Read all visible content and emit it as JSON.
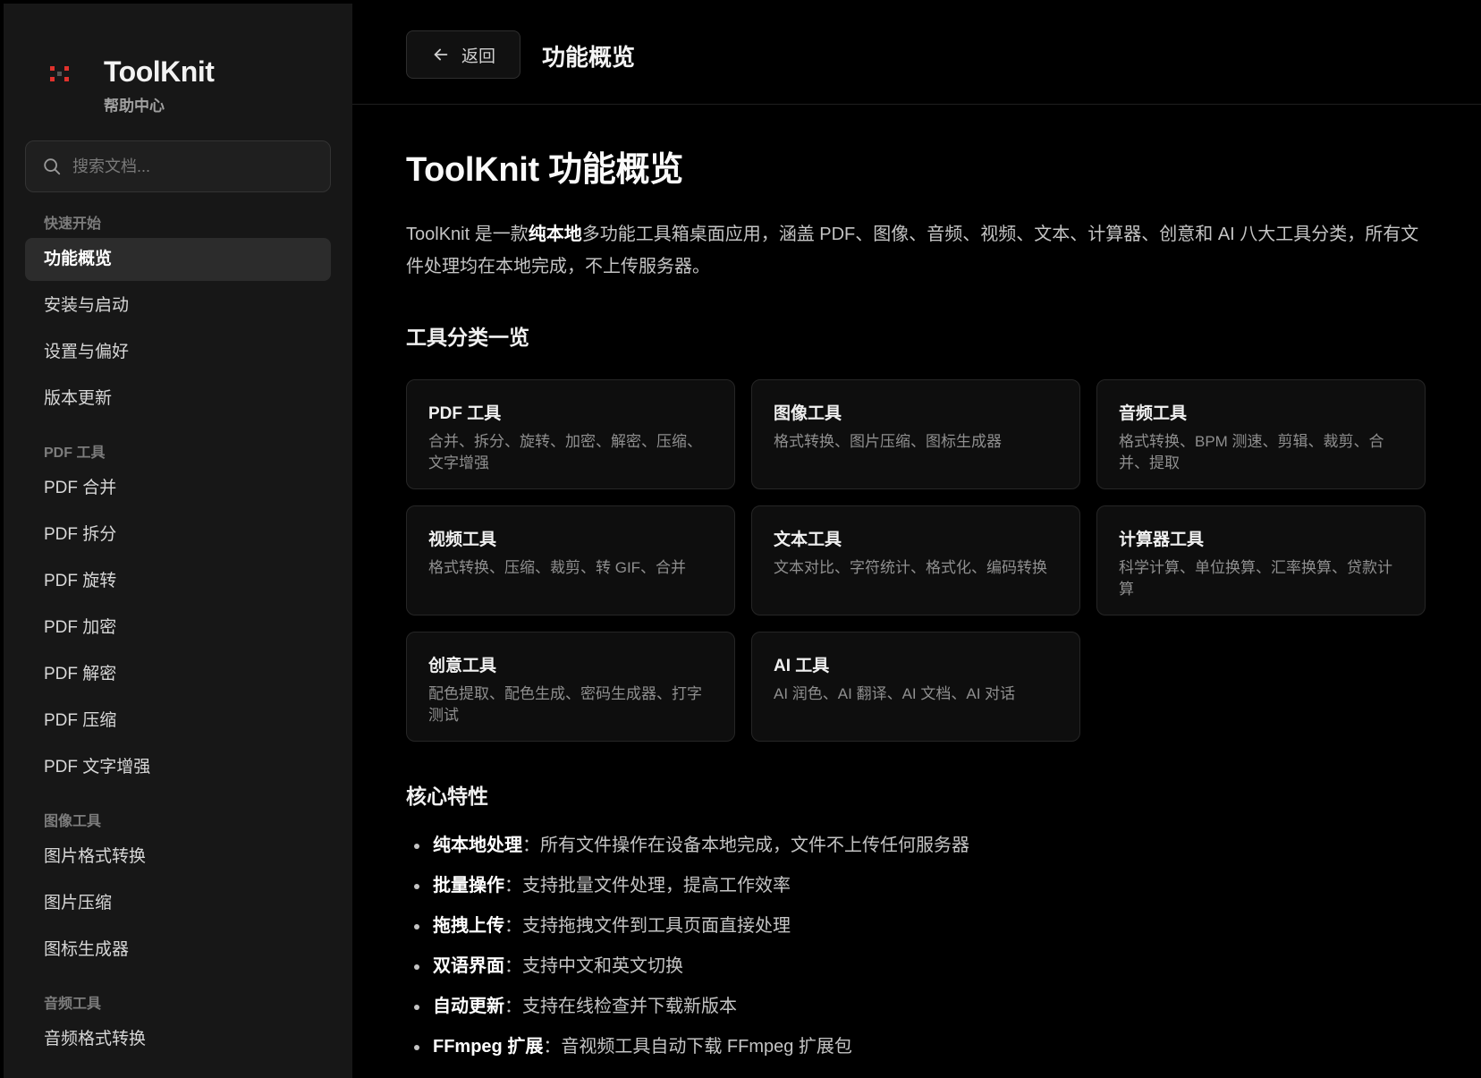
{
  "sidebar": {
    "brand_name": "ToolKnit",
    "brand_sub": "帮助中心",
    "search_placeholder": "搜索文档...",
    "sections": [
      {
        "title": "快速开始",
        "items": [
          "功能概览",
          "安装与启动",
          "设置与偏好",
          "版本更新"
        ]
      },
      {
        "title": "PDF 工具",
        "items": [
          "PDF 合并",
          "PDF 拆分",
          "PDF 旋转",
          "PDF 加密",
          "PDF 解密",
          "PDF 压缩",
          "PDF 文字增强"
        ]
      },
      {
        "title": "图像工具",
        "items": [
          "图片格式转换",
          "图片压缩",
          "图标生成器"
        ]
      },
      {
        "title": "音频工具",
        "items": [
          "音频格式转换"
        ]
      }
    ],
    "active_item": "功能概览"
  },
  "topbar": {
    "back_label": "返回",
    "title": "功能概览"
  },
  "content": {
    "h1": "ToolKnit 功能概览",
    "intro_before": "ToolKnit 是一款",
    "intro_bold": "纯本地",
    "intro_after": "多功能工具箱桌面应用，涵盖 PDF、图像、音频、视频、文本、计算器、创意和 AI 八大工具分类，所有文件处理均在本地完成，不上传服务器。",
    "tools_heading": "工具分类一览",
    "cards": [
      {
        "title": "PDF 工具",
        "desc": "合并、拆分、旋转、加密、解密、压缩、文字增强"
      },
      {
        "title": "图像工具",
        "desc": "格式转换、图片压缩、图标生成器"
      },
      {
        "title": "音频工具",
        "desc": "格式转换、BPM 测速、剪辑、裁剪、合并、提取"
      },
      {
        "title": "视频工具",
        "desc": "格式转换、压缩、裁剪、转 GIF、合并"
      },
      {
        "title": "文本工具",
        "desc": "文本对比、字符统计、格式化、编码转换"
      },
      {
        "title": "计算器工具",
        "desc": "科学计算、单位换算、汇率换算、贷款计算"
      },
      {
        "title": "创意工具",
        "desc": "配色提取、配色生成、密码生成器、打字测试"
      },
      {
        "title": "AI 工具",
        "desc": "AI 润色、AI 翻译、AI 文档、AI 对话"
      }
    ],
    "features_heading": "核心特性",
    "features": [
      {
        "bold": "纯本地处理",
        "text": "：所有文件操作在设备本地完成，文件不上传任何服务器"
      },
      {
        "bold": "批量操作",
        "text": "：支持批量文件处理，提高工作效率"
      },
      {
        "bold": "拖拽上传",
        "text": "：支持拖拽文件到工具页面直接处理"
      },
      {
        "bold": "双语界面",
        "text": "：支持中文和英文切换"
      },
      {
        "bold": "自动更新",
        "text": "：支持在线检查并下载新版本"
      },
      {
        "bold": "FFmpeg 扩展",
        "text": "：音视频工具自动下载 FFmpeg 扩展包"
      }
    ]
  },
  "icons": {
    "logo": "toolknit-logo-icon",
    "search": "search-icon",
    "back": "arrow-left-icon"
  },
  "colors": {
    "logo_red": "#e0322d",
    "logo_dark": "#5a5a5a"
  }
}
